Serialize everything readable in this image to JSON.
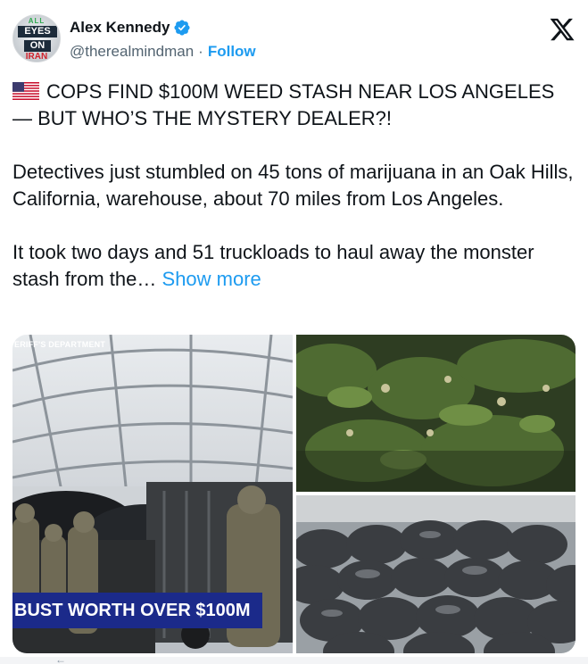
{
  "author": {
    "display_name": "Alex Kennedy",
    "handle": "@therealmindman",
    "separator": "·",
    "follow_label": "Follow",
    "avatar_text": {
      "top": "ALL",
      "line1": "EYES",
      "line2": "ON",
      "line3": "IRAN"
    }
  },
  "tweet": {
    "headline": "COPS FIND $100M WEED STASH NEAR LOS ANGELES — BUT WHO’S THE MYSTERY DEALER?!",
    "paragraph1": "Detectives just stumbled on 45 tons of marijuana in an Oak Hills, California, warehouse, about 70 miles from Los Angeles.",
    "paragraph2": "It took two days and 51 truckloads to haul away the monster stash from the…",
    "show_more_label": "Show more"
  },
  "media": {
    "left_caption_top": "ERIFF'S DEPARTMENT",
    "left_banner": "BUST WORTH OVER $100M"
  },
  "icons": {
    "verified": "verified-badge-icon",
    "platform": "x-logo-icon",
    "flag": "us-flag-icon"
  },
  "colors": {
    "accent": "#1d9bf0",
    "banner": "#1b2a8a",
    "text": "#0f1419",
    "muted": "#536471"
  }
}
